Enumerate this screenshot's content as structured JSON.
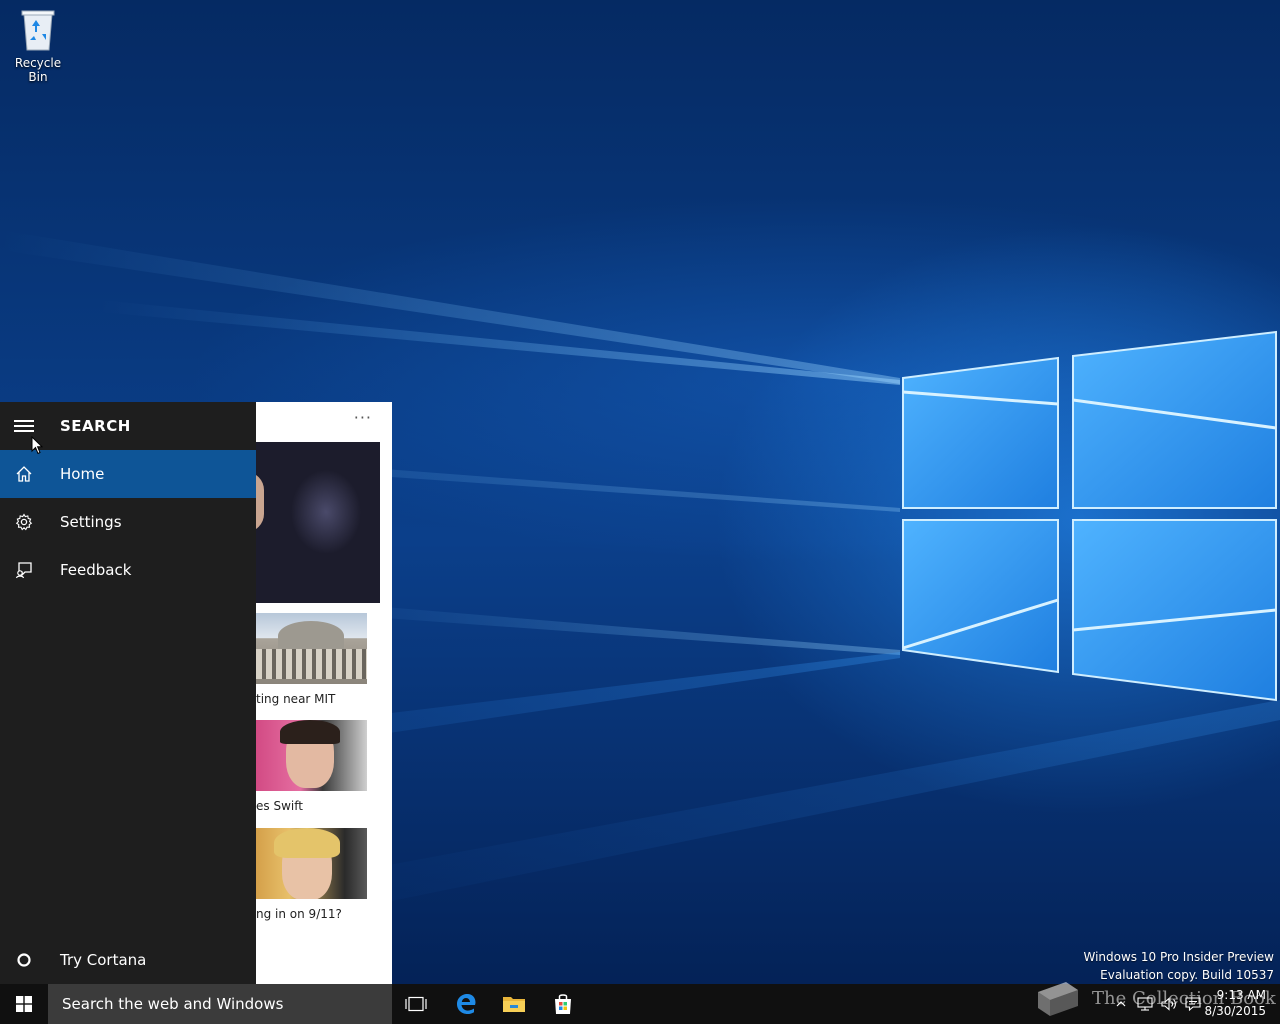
{
  "desktop": {
    "icons": [
      {
        "label": "Recycle Bin",
        "icon": "recycle-bin-icon"
      }
    ],
    "watermark": {
      "line1": "Windows 10 Pro Insider Preview",
      "line2": "Evaluation copy. Build 10537"
    }
  },
  "search_flyout": {
    "title": "SEARCH",
    "nav_items": [
      {
        "label": "Home",
        "icon": "home-icon",
        "active": true
      },
      {
        "label": "Settings",
        "icon": "gear-icon",
        "active": false
      },
      {
        "label": "Feedback",
        "icon": "feedback-icon",
        "active": false
      }
    ],
    "bottom_item": {
      "label": "Try Cortana",
      "icon": "cortana-circle-icon"
    },
    "news": [
      {
        "caption": "ting near MIT"
      },
      {
        "caption": "es Swift"
      },
      {
        "caption": "ng in on 9/11?"
      }
    ],
    "more_label": "···"
  },
  "taskbar": {
    "search_placeholder": "Search the web and Windows",
    "pinned": [
      "task-view-icon",
      "edge-icon",
      "file-explorer-icon",
      "store-icon"
    ],
    "clock": {
      "time": "9:13 AM",
      "date": "8/30/2015"
    },
    "overlay_watermark": "The Collection Book"
  },
  "colors": {
    "accent": "#0e5597",
    "flyout_bg": "#1e1e1e",
    "taskbar_bg": "#101010",
    "search_bg": "#3b3b3b"
  }
}
